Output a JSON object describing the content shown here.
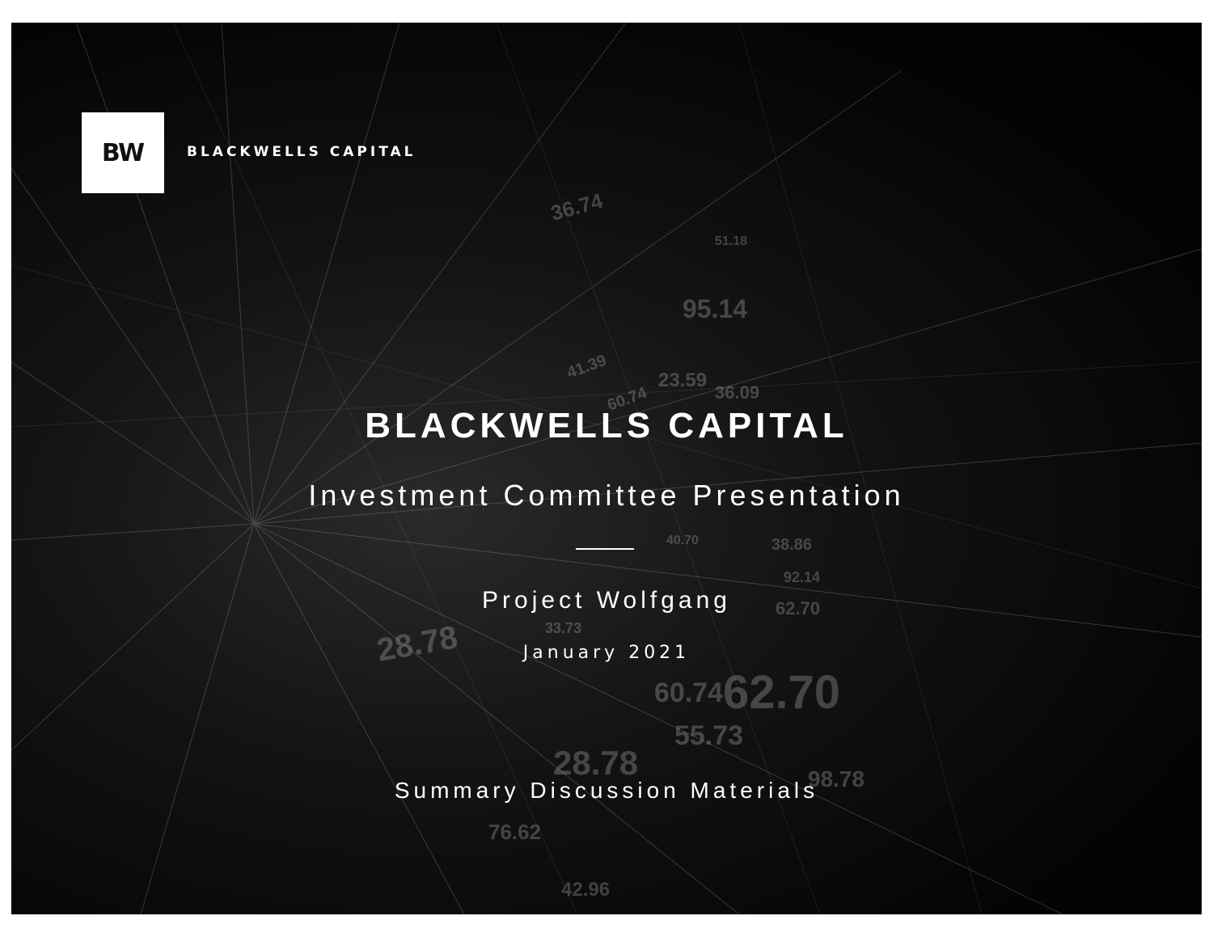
{
  "logo": {
    "mark": "BW",
    "wordmark": "BLACKWELLS CAPITAL"
  },
  "cover": {
    "title": "BLACKWELLS CAPITAL",
    "subtitle": "Investment Committee Presentation",
    "project": "Project Wolfgang",
    "date": "January 2021",
    "footer": "Summary Discussion Materials"
  },
  "background": {
    "ticker_numbers": [
      "36.74",
      "51.18",
      "95.14",
      "23.59",
      "36.09",
      "38.86",
      "92.14",
      "62.70",
      "60.74",
      "62.70",
      "55.73",
      "28.78",
      "98.78",
      "76.62",
      "42.96",
      "28.78",
      "40.70",
      "33.73",
      "41.39",
      "60.74"
    ]
  },
  "colors": {
    "slide_background": "#000000",
    "text": "#ffffff",
    "page_background": "#ffffff"
  }
}
